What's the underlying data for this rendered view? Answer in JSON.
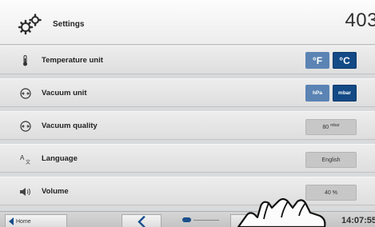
{
  "header": {
    "title": "Settings",
    "program_number": "403",
    "settings_icon": "gears-icon"
  },
  "rows": {
    "temperature": {
      "label": "Temperature unit",
      "icon": "thermometer-icon",
      "option_f": "°F",
      "option_c": "°C",
      "selected": "°C"
    },
    "vacuum_unit": {
      "label": "Vacuum unit",
      "icon": "vacuum-gauge-icon",
      "option_hpa": "hPa",
      "option_mbar": "mbar",
      "selected": "mbar"
    },
    "vacuum_quality": {
      "label": "Vacuum quality",
      "icon": "vacuum-gauge-icon",
      "value": "80",
      "unit": "mbar"
    },
    "language": {
      "label": "Language",
      "icon": "language-icon",
      "value": "English"
    },
    "volume": {
      "label": "Volume",
      "icon": "speaker-icon",
      "value": "40 %"
    }
  },
  "footer": {
    "home_label": "Home",
    "back_icon": "chevron-left-icon",
    "page_current": 1,
    "page_total": 2,
    "clock": "14:07:55",
    "pointer": "hand-pointer-icon"
  },
  "colors": {
    "accent": "#134a86",
    "accent_light": "#5b84b4",
    "row_bg": "#e6e6e6",
    "value_box_bg": "#c7c7c7"
  }
}
